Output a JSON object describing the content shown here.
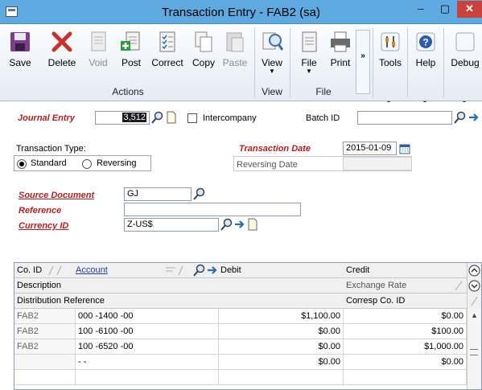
{
  "window": {
    "title": "Transaction Entry  -  FAB2 (sa)",
    "minimize": "–",
    "maximize": "▢",
    "close": "✕"
  },
  "ribbon": {
    "actions": {
      "save": "Save",
      "delete": "Delete",
      "void": "Void",
      "post": "Post",
      "correct": "Correct",
      "copy": "Copy",
      "paste": "Paste",
      "group": "Actions"
    },
    "view": {
      "view": "View",
      "group": "View"
    },
    "file": {
      "file": "File",
      "print": "Print",
      "group": "File"
    },
    "more": "»",
    "tools": "Tools",
    "help": "Help",
    "debug": "Debug"
  },
  "form": {
    "journal_entry_label": "Journal Entry",
    "journal_entry_value": "3,512",
    "intercompany_label": "Intercompany",
    "intercompany_checked": false,
    "batch_id_label": "Batch ID",
    "batch_id_value": "",
    "transaction_type_label": "Transaction Type:",
    "type_standard": "Standard",
    "type_reversing": "Reversing",
    "transaction_type_selected": "Standard",
    "transaction_date_label": "Transaction Date",
    "transaction_date_value": "2015-01-09",
    "reversing_date_label": "Reversing Date",
    "reversing_date_value": "",
    "source_document_label": "Source Document",
    "source_document_value": "GJ",
    "reference_label": "Reference",
    "reference_value": "",
    "currency_id_label": "Currency ID",
    "currency_id_value": "Z-US$"
  },
  "grid": {
    "headers": {
      "co_id": "Co. ID",
      "account": "Account",
      "debit": "Debit",
      "credit": "Credit",
      "description": "Description",
      "exchange_rate": "Exchange Rate",
      "distribution_reference": "Distribution Reference",
      "corresp_co_id": "Corresp Co. ID"
    },
    "rows": [
      {
        "co_id": "FAB2",
        "account": "000 -1400 -00",
        "debit": "$1,100.00",
        "credit": "$0.00"
      },
      {
        "co_id": "FAB2",
        "account": "100 -6100 -00",
        "debit": "$0.00",
        "credit": "$100.00"
      },
      {
        "co_id": "FAB2",
        "account": "100 -6520 -00",
        "debit": "$0.00",
        "credit": "$1,000.00"
      },
      {
        "co_id": "",
        "account": "   -      -",
        "debit": "$0.00",
        "credit": "$0.00"
      }
    ]
  },
  "colors": {
    "titlebar": "#5ea9e0",
    "required_label": "#b01f1f",
    "close_button": "#c7433b"
  }
}
